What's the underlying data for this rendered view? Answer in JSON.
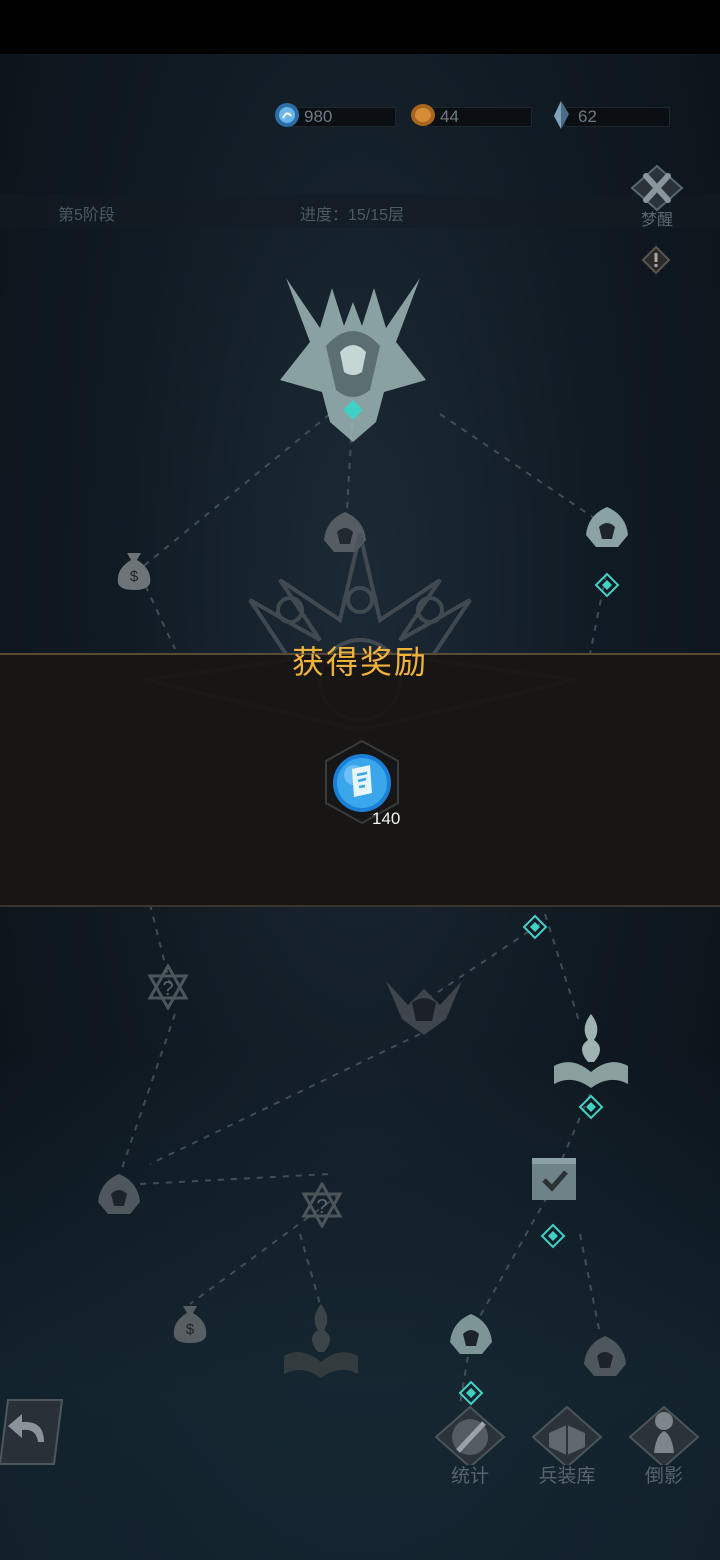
{
  "resources": [
    {
      "icon": "blue-swirl-orb-icon",
      "value": "980"
    },
    {
      "icon": "gold-coin-icon",
      "value": "44"
    },
    {
      "icon": "crystal-shard-icon",
      "value": "62"
    }
  ],
  "stage": {
    "label": "第5阶段",
    "progress": "进度：15/15层"
  },
  "wake_button": {
    "label": "梦醒"
  },
  "modal": {
    "title": "获得奖励",
    "reward": {
      "icon": "blue-scroll-orb-icon",
      "count": "140"
    }
  },
  "bottom_nav": [
    {
      "icon": "shield-sword-icon",
      "label": "统计"
    },
    {
      "icon": "armory-book-icon",
      "label": "兵装库"
    },
    {
      "icon": "pawn-icon",
      "label": "倒影"
    }
  ],
  "colors": {
    "accent": "#f0b33a",
    "path_teal": "#48c8c0",
    "background": "#111b24"
  }
}
